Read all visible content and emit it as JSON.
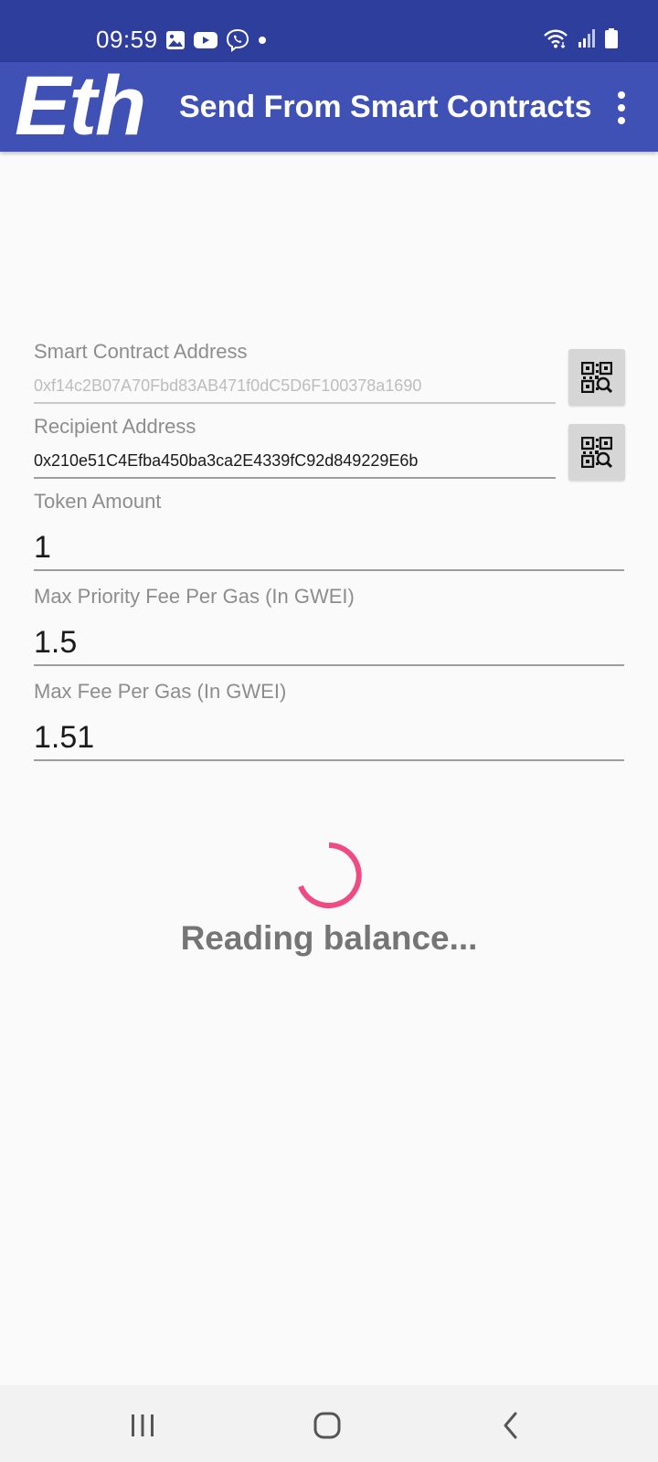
{
  "status_bar": {
    "time": "09:59",
    "left_icons": [
      "gallery-icon",
      "youtube-icon",
      "viber-icon",
      "notification-dot-icon"
    ],
    "right_icons": [
      "wifi-icon",
      "signal-icon",
      "battery-icon"
    ],
    "background": "#2d3e9d"
  },
  "app_bar": {
    "logo": "Eth",
    "title": "Send From Smart Contracts",
    "menu_icon": "overflow-menu-icon",
    "background": "#3f51b5"
  },
  "form": {
    "contract_address": {
      "label": "Smart Contract Address",
      "value": "0xf14c2B07A70Fbd83AB471f0dC5D6F100378a1690",
      "enabled": false,
      "scan_icon": "qr-scan-icon"
    },
    "recipient_address": {
      "label": "Recipient Address",
      "value": "0x210e51C4Efba450ba3ca2E4339fC92d849229E6b",
      "scan_icon": "qr-scan-icon"
    },
    "token_amount": {
      "label": "Token Amount",
      "value": "1"
    },
    "max_priority_fee": {
      "label": "Max Priority Fee Per Gas (In GWEI)",
      "value": "1.5"
    },
    "max_fee": {
      "label": "Max Fee Per Gas (In GWEI)",
      "value": "1.51"
    }
  },
  "progress": {
    "text": "Reading balance...",
    "spinner_color": "#f04a82"
  },
  "nav_bar": {
    "icons": [
      "recent-apps-icon",
      "home-icon",
      "back-icon"
    ]
  }
}
